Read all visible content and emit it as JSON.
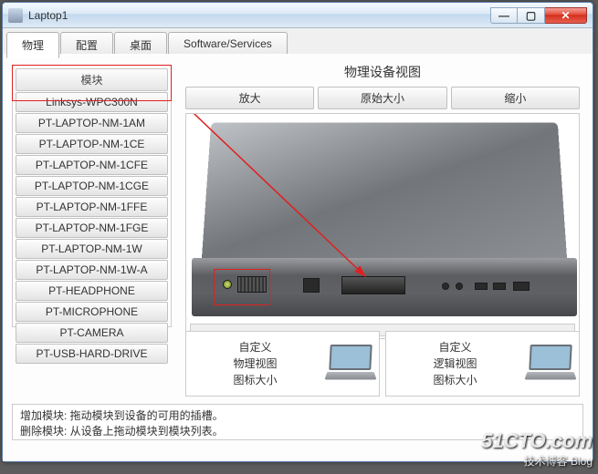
{
  "window": {
    "title": "Laptop1"
  },
  "tabs": {
    "t1": "物理",
    "t2": "配置",
    "t3": "桌面",
    "t4": "Software/Services"
  },
  "sidebar": {
    "header": "模块",
    "items": [
      "Linksys-WPC300N",
      "PT-LAPTOP-NM-1AM",
      "PT-LAPTOP-NM-1CE",
      "PT-LAPTOP-NM-1CFE",
      "PT-LAPTOP-NM-1CGE",
      "PT-LAPTOP-NM-1FFE",
      "PT-LAPTOP-NM-1FGE",
      "PT-LAPTOP-NM-1W",
      "PT-LAPTOP-NM-1W-A",
      "PT-HEADPHONE",
      "PT-MICROPHONE",
      "PT-CAMERA",
      "PT-USB-HARD-DRIVE"
    ]
  },
  "main": {
    "title": "物理设备视图",
    "zoom_in": "放大",
    "zoom_orig": "原始大小",
    "zoom_out": "缩小"
  },
  "bottom": {
    "left": "自定义\n物理视图\n图标大小",
    "right": "自定义\n逻辑视图\n图标大小"
  },
  "help": {
    "line1": "增加模块: 拖动模块到设备的可用的插槽。",
    "line2": "删除模块: 从设备上拖动模块到模块列表。"
  },
  "watermark": {
    "big": "51CTO.com",
    "small": "技术博客  Blog"
  }
}
